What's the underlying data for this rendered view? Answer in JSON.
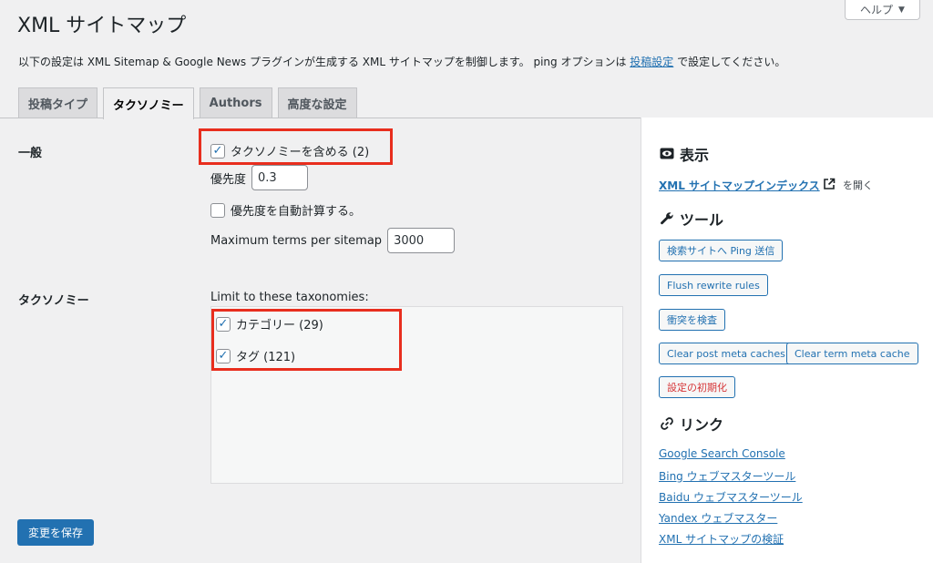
{
  "page": {
    "title": "XML サイトマップ",
    "help_label": "ヘルプ",
    "description_before": "以下の設定は XML Sitemap & Google News プラグインが生成する XML サイトマップを制御します。 ping オプションは ",
    "description_link": "投稿設定",
    "description_after": " で設定してください。"
  },
  "tabs": [
    {
      "label": "投稿タイプ"
    },
    {
      "label": "タクソノミー"
    },
    {
      "label": "Authors"
    },
    {
      "label": "高度な設定"
    }
  ],
  "general": {
    "label": "一般",
    "include_taxonomies": "タクソノミーを含める (2)",
    "priority_label": "優先度",
    "priority_value": "0.3",
    "auto_priority": "優先度を自動計算する。",
    "max_terms_label": "Maximum terms per sitemap",
    "max_terms_value": "3000"
  },
  "taxonomies": {
    "label": "タクソノミー",
    "limit_label": "Limit to these taxonomies:",
    "items": [
      {
        "label": "カテゴリー (29)",
        "checked": true
      },
      {
        "label": "タグ (121)",
        "checked": true
      }
    ]
  },
  "save_button": "変更を保存",
  "sidebar": {
    "view_heading": "表示",
    "index_link": "XML サイトマップインデックス",
    "index_after": "を開く",
    "tools_heading": "ツール",
    "tool_buttons": [
      "検索サイトへ Ping 送信",
      "Flush rewrite rules",
      "衝突を検査",
      "Clear post meta caches",
      "Clear term meta cache",
      "設定の初期化"
    ],
    "links_heading": "リンク",
    "links": [
      "Google Search Console",
      "Bing ウェブマスターツール",
      "Baidu ウェブマスターツール",
      "Yandex ウェブマスター",
      "XML サイトマップの検証"
    ]
  },
  "colors": {
    "accent": "#2271b1",
    "highlight": "#e82e1e",
    "danger": "#d63638"
  }
}
